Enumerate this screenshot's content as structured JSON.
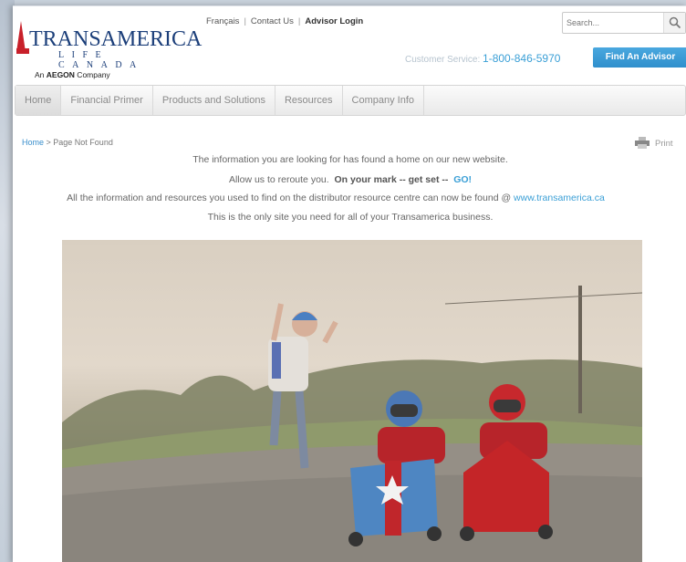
{
  "header": {
    "logo": {
      "name": "TRANSAMERICA",
      "sub": "LIFE CANADA",
      "tagline_prefix": "An ",
      "tagline_bold": "AEGON",
      "tagline_suffix": " Company"
    },
    "toplinks": {
      "francais": "Français",
      "contact": "Contact Us",
      "advisor_login": "Advisor Login"
    },
    "search": {
      "placeholder": "Search..."
    },
    "customer_service": {
      "label": "Customer Service:",
      "phone": "1-800-846-5970"
    },
    "find_advisor": "Find An Advisor"
  },
  "nav": {
    "items": [
      {
        "label": "Home"
      },
      {
        "label": "Financial Primer"
      },
      {
        "label": "Products and Solutions"
      },
      {
        "label": "Resources"
      },
      {
        "label": "Company Info"
      }
    ]
  },
  "breadcrumb": {
    "home": "Home",
    "separator": " > ",
    "current": "Page Not Found"
  },
  "print_label": "Print",
  "message": {
    "line1": "The information you are looking for has found a home on our new website.",
    "line2_prefix": "Allow us to reroute you.",
    "line2_mark": "On your mark -- get set --",
    "line2_go": "GO!",
    "line3_text": "All the information and resources you used to find on the distributor resource centre can now be found @",
    "line3_link": "www.transamerica.ca",
    "line4": "This is the only site you need for all of your Transamerica business."
  },
  "colors": {
    "brand_blue": "#1c3f7a",
    "brand_red": "#c8202a",
    "link_blue": "#3a9fd6",
    "button_blue": "#3a9bd9"
  }
}
